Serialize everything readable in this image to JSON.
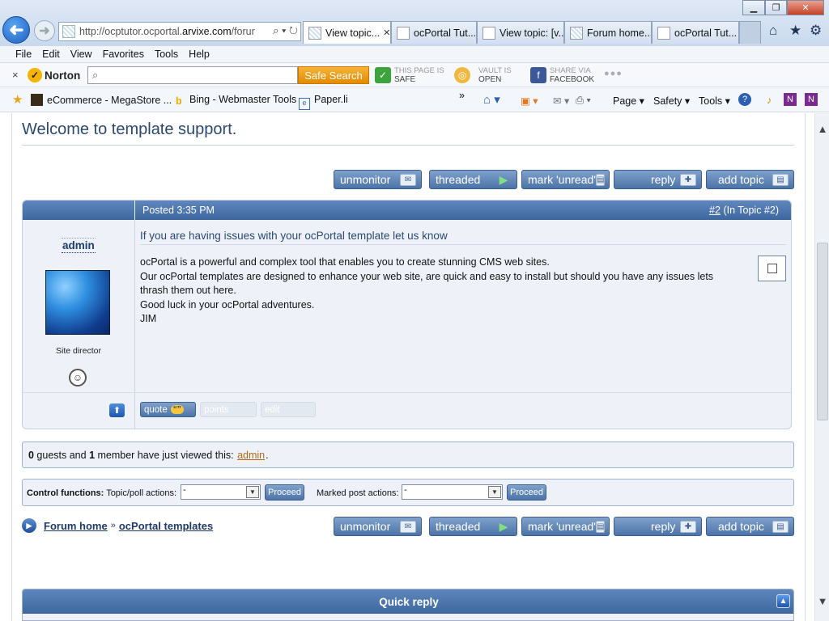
{
  "browser": {
    "address_url": "http://ocptutor.ocportal.",
    "address_url_dark": "arvixe.com",
    "address_url_rest": "/forur",
    "address_icons": "⌕ ▾ ↻",
    "back_symbol": "➜",
    "forward_symbol": "➜",
    "tabs": [
      {
        "label": "View topic...",
        "close": "✕"
      },
      {
        "label": "ocPortal Tut..."
      },
      {
        "label": "View topic: [v..."
      },
      {
        "label": "Forum home..."
      },
      {
        "label": "ocPortal Tut..."
      }
    ],
    "window_buttons": {
      "minimize": "▁",
      "maximize": "❐",
      "close": "✕"
    },
    "chrome_icons": {
      "home": "⌂",
      "favorites": "★",
      "tools": "⚙"
    }
  },
  "menubar": {
    "items": [
      "File",
      "Edit",
      "View",
      "Favorites",
      "Tools",
      "Help"
    ]
  },
  "norton": {
    "close": "×",
    "logo": "Norton",
    "search_placeholder": "",
    "search_icon": "⌕",
    "safe_search_label": "Safe Search",
    "page_status_label": "THIS PAGE IS",
    "page_status_value": "SAFE",
    "vault_label": "VAULT IS",
    "vault_value": "OPEN",
    "share_label": "SHARE VIA",
    "share_value": "FACEBOOK",
    "more": "●●●"
  },
  "favorites_bar": {
    "items": [
      "eCommerce - MegaStore ...",
      "Bing - Webmaster Tools",
      "Paper.li"
    ],
    "overflow": "»",
    "commands": [
      "Page ▾",
      "Safety ▾",
      "Tools ▾"
    ]
  },
  "page": {
    "title": "Welcome to template support.",
    "action_buttons": {
      "unmonitor": "unmonitor",
      "threaded": "threaded",
      "mark_unread": "mark 'unread'",
      "reply": "reply",
      "add_topic": "add topic"
    },
    "post": {
      "posted": "Posted 3:35 PM",
      "post_number": "#2",
      "post_number_suffix": "(In Topic #2)",
      "poster_name": "admin",
      "poster_title": "Site director",
      "subject": "If you are having issues with your ocPortal template let us know",
      "body_lines": [
        "ocPortal is a powerful and complex tool that enables you to create stunning CMS web sites.",
        "Our ocPortal templates are designed to enhance your web site, are quick and easy to install but should you have any issues lets thrash them out here.",
        "Good luck in your ocPortal adventures.",
        "JIM"
      ],
      "quote_label": "quote",
      "quote_icon": "“”",
      "points_label": "points",
      "edit_label": "edit"
    },
    "viewers": {
      "guests_count": "0",
      "guests_text": " guests and ",
      "members_count": "1",
      "members_text": " member have just viewed this: ",
      "member_link": "admin",
      "end": "."
    },
    "control_functions": {
      "label": "Control functions:",
      "topic_actions_label": "Topic/poll actions:",
      "topic_select_value": "-",
      "proceed_1": "Proceed",
      "marked_actions_label": "Marked post actions:",
      "marked_select_value": "-",
      "proceed_2": "Proceed"
    },
    "breadcrumb": {
      "home": "Forum home",
      "sep": "»",
      "current": "ocPortal templates"
    },
    "quick_reply": {
      "title": "Quick reply"
    }
  }
}
